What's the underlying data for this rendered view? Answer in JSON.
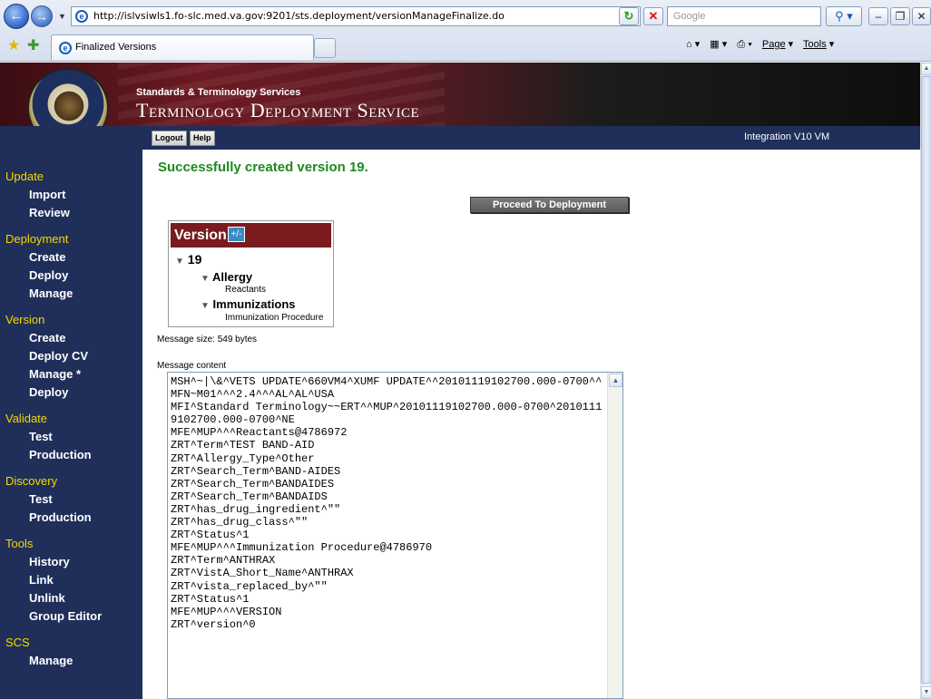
{
  "browser": {
    "url": "http://islvsiwls1.fo-slc.med.va.gov:9201/sts.deployment/versionManageFinalize.do",
    "search_placeholder": "Google",
    "tab_title": "Finalized Versions",
    "commands": {
      "page": "Page",
      "tools": "Tools"
    },
    "icons": {
      "back": "back-arrow-icon",
      "forward": "forward-arrow-icon",
      "refresh": "refresh-icon",
      "stop": "stop-icon",
      "search": "search-icon",
      "home": "home-icon",
      "feeds": "rss-feed-icon",
      "print": "printer-icon",
      "favorites": "star-icon",
      "add_favorites": "add-favorites-icon"
    }
  },
  "header": {
    "subtitle": "Standards & Terminology Services",
    "title": "Terminology Deployment Service",
    "logout_label": "Logout",
    "help_label": "Help",
    "environment": "Integration V10 VM"
  },
  "sidebar": {
    "update": {
      "label": "Update",
      "items": [
        "Import",
        "Review"
      ]
    },
    "deployment": {
      "label": "Deployment",
      "items": [
        "Create",
        "Deploy",
        "Manage"
      ]
    },
    "version": {
      "label": "Version",
      "items": [
        "Create",
        "Deploy CV",
        "Manage *",
        "Deploy"
      ]
    },
    "validate": {
      "label": "Validate",
      "items": [
        "Test",
        "Production"
      ]
    },
    "discovery": {
      "label": "Discovery",
      "items": [
        "Test",
        "Production"
      ]
    },
    "tools": {
      "label": "Tools",
      "items": [
        "History",
        "Link",
        "Unlink",
        "Group Editor"
      ]
    },
    "scs": {
      "label": "SCS",
      "items": [
        "Manage"
      ]
    }
  },
  "main": {
    "success_message": "Successfully created version 19.",
    "proceed_label": "Proceed To Deployment",
    "version_tree": {
      "title": "Version",
      "toggle_label": "+/-",
      "root": "19",
      "nodes": [
        {
          "label": "Allergy",
          "leaf": "Reactants"
        },
        {
          "label": "Immunizations",
          "leaf": "Immunization Procedure"
        }
      ]
    },
    "message_size": "Message size: 549 bytes",
    "message_content_label": "Message content",
    "message_text": "MSH^~|\\&^VETS UPDATE^660VM4^XUMF UPDATE^^20101119102700.000-0700^^MFN~M01^^^2.4^^^AL^AL^USA\nMFI^Standard Terminology~~ERT^^MUP^20101119102700.000-0700^20101119102700.000-0700^NE\nMFE^MUP^^^Reactants@4786972\nZRT^Term^TEST BAND-AID\nZRT^Allergy_Type^Other\nZRT^Search_Term^BAND-AIDES\nZRT^Search_Term^BANDAIDES\nZRT^Search_Term^BANDAIDS\nZRT^has_drug_ingredient^\"\"\nZRT^has_drug_class^\"\"\nZRT^Status^1\nMFE^MUP^^^Immunization Procedure@4786970\nZRT^Term^ANTHRAX\nZRT^VistA_Short_Name^ANTHRAX\nZRT^vista_replaced_by^\"\"\nZRT^Status^1\nMFE^MUP^^^VERSION\nZRT^version^0"
  }
}
